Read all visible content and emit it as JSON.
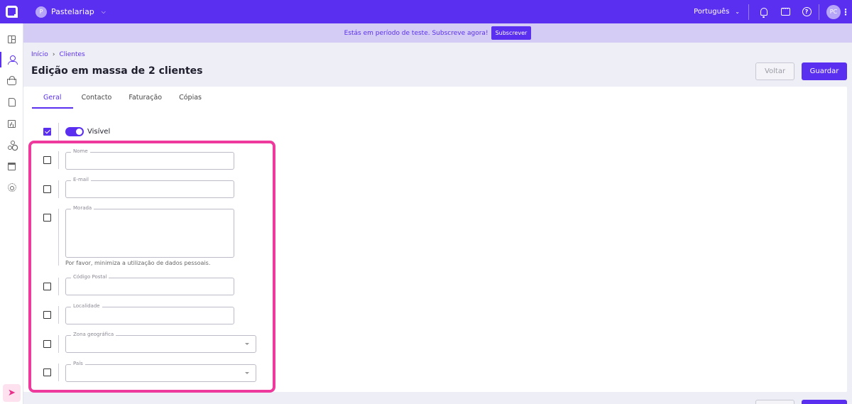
{
  "topbar": {
    "company_initial": "P",
    "company_name": "Pastelariap",
    "language": "Português",
    "avatar_initials": "PC"
  },
  "banner": {
    "text": "Estás em período de teste. Subscreve agora!",
    "button": "Subscrever"
  },
  "breadcrumb": {
    "home": "Início",
    "current": "Clientes"
  },
  "page": {
    "title": "Edição em massa de 2 clientes",
    "back_label": "Voltar",
    "save_label": "Guardar"
  },
  "tabs": [
    "Geral",
    "Contacto",
    "Faturação",
    "Cópias"
  ],
  "visible_toggle": {
    "label": "Visível",
    "checked": true,
    "on": true
  },
  "fields": {
    "nome": "Nome",
    "email": "E-mail",
    "morada": "Morada",
    "morada_helper": "Por favor, minimiza a utilização de dados pessoais.",
    "codigo_postal": "Código Postal",
    "localidade": "Localidade",
    "zona_geografica": "Zona geográfica",
    "pais": "País"
  },
  "colors": {
    "brand": "#5b2ff0",
    "highlight": "#ee3a9c"
  }
}
